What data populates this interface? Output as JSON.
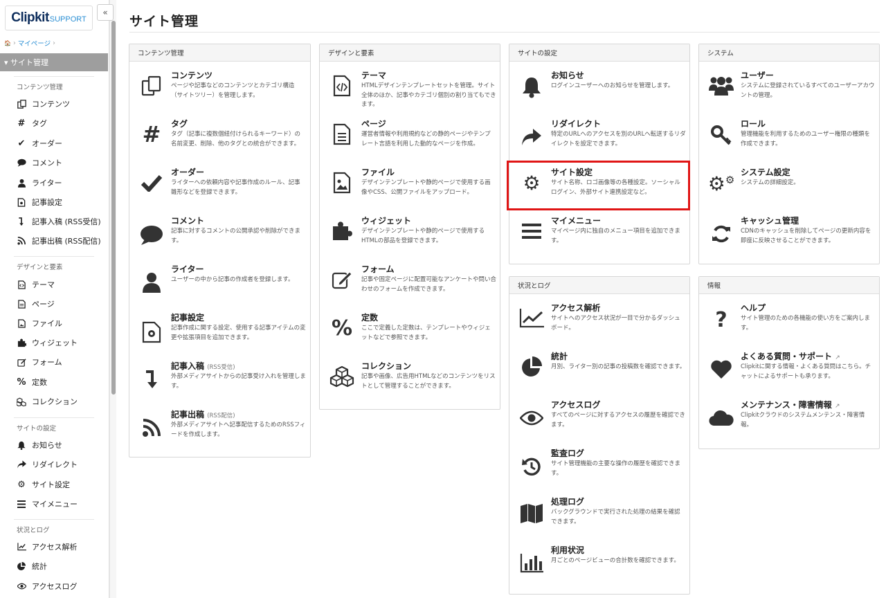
{
  "sidebar": {
    "logo_main": "Clipkit",
    "logo_sub": "SUPPORT",
    "collapse": "«",
    "breadcrumb": {
      "home": "🏠",
      "sep": "›",
      "mypage": "マイページ"
    },
    "active_section": "▾ サイト管理",
    "groups": [
      {
        "title": "コンテンツ管理",
        "items": [
          "コンテンツ",
          "タグ",
          "オーダー",
          "コメント",
          "ライター",
          "記事設定",
          "記事入稿 (RSS受信)",
          "記事出稿 (RSS配信)"
        ]
      },
      {
        "title": "デザインと要素",
        "items": [
          "テーマ",
          "ページ",
          "ファイル",
          "ウィジェット",
          "フォーム",
          "定数",
          "コレクション"
        ]
      },
      {
        "title": "サイトの設定",
        "items": [
          "お知らせ",
          "リダイレクト",
          "サイト設定",
          "マイメニュー"
        ]
      },
      {
        "title": "状況とログ",
        "items": [
          "アクセス解析",
          "統計",
          "アクセスログ"
        ]
      }
    ]
  },
  "main": {
    "title": "サイト管理",
    "panels": {
      "content": {
        "title": "コンテンツ管理",
        "items": [
          {
            "title": "コンテンツ",
            "desc": "ページや記事などのコンテンツとカテゴリ構造（サイトツリー）を管理します。"
          },
          {
            "title": "タグ",
            "desc": "タグ（記事に複数個紐付けられるキーワード）の名前変更、削除、他のタグとの統合ができます。"
          },
          {
            "title": "オーダー",
            "desc": "ライターへの依頼内容や記事作成のルール、記事雛形などを登録できます。"
          },
          {
            "title": "コメント",
            "desc": "記事に対するコメントの公開承認や削除ができます。"
          },
          {
            "title": "ライター",
            "desc": "ユーザーの中から記事の作成者を登録します。"
          },
          {
            "title": "記事設定",
            "desc": "記事作成に関する設定、使用する記事アイテムの変更や拡張項目を追加できます。"
          },
          {
            "title": "記事入稿",
            "sub": "(RSS受信)",
            "desc": "外部メディアサイトからの記事受け入れを管理します。"
          },
          {
            "title": "記事出稿",
            "sub": "(RSS配信)",
            "desc": "外部メディアサイトへ記事配信するためのRSSフィードを作成します。"
          }
        ]
      },
      "design": {
        "title": "デザインと要素",
        "items": [
          {
            "title": "テーマ",
            "desc": "HTMLデザインテンプレートセットを管理。サイト全体のほか、記事やカテゴリ個別の割り当てもできます。"
          },
          {
            "title": "ページ",
            "desc": "運営者情報や利用規約などの静的ページやテンプレート言語を利用した動的なページを作成。"
          },
          {
            "title": "ファイル",
            "desc": "デザインテンプレートや静的ページで使用する画像やCSS、公開ファイルをアップロード。"
          },
          {
            "title": "ウィジェット",
            "desc": "デザインテンプレートや静的ページで使用するHTMLの部品を登録できます。"
          },
          {
            "title": "フォーム",
            "desc": "記事や固定ページに配置可能なアンケートや問い合わせのフォームを作成できます。"
          },
          {
            "title": "定数",
            "desc": "ここで定義した定数は、テンプレートやウィジェットなどで参照できます。"
          },
          {
            "title": "コレクション",
            "desc": "記事や画像、広告用HTMLなどのコンテンツをリストとして管理することができます。"
          }
        ]
      },
      "site": {
        "title": "サイトの設定",
        "items": [
          {
            "title": "お知らせ",
            "desc": "ログインユーザーへのお知らせを管理します。"
          },
          {
            "title": "リダイレクト",
            "desc": "特定のURLへのアクセスを別のURLへ転送するリダイレクトを設定できます。"
          },
          {
            "title": "サイト設定",
            "desc": "サイト名称、ロゴ画像等の各種設定。ソーシャルログイン、外部サイト連携設定など。"
          },
          {
            "title": "マイメニュー",
            "desc": "マイページ内に独自のメニュー項目を追加できます。"
          }
        ]
      },
      "system": {
        "title": "システム",
        "items": [
          {
            "title": "ユーザー",
            "desc": "システムに登録されているすべてのユーザーアカウントの管理。"
          },
          {
            "title": "ロール",
            "desc": "管理機能を利用するためのユーザー権限の種類を作成できます。"
          },
          {
            "title": "システム設定",
            "desc": "システムの詳細設定。"
          },
          {
            "title": "キャッシュ管理",
            "desc": "CDNのキャッシュを削除してページの更新内容を即座に反映させることができます。"
          }
        ]
      },
      "logs": {
        "title": "状況とログ",
        "items": [
          {
            "title": "アクセス解析",
            "desc": "サイトへのアクセス状況が一目で分かるダッシュボード。"
          },
          {
            "title": "統計",
            "desc": "月別、ライター別の記事の投稿数を確認できます。"
          },
          {
            "title": "アクセスログ",
            "desc": "すべてのページに対するアクセスの履歴を確認できます。"
          },
          {
            "title": "監査ログ",
            "desc": "サイト管理機能の主要な操作の履歴を確認できます。"
          },
          {
            "title": "処理ログ",
            "desc": "バックグラウンドで実行された処理の結果を確認できます。"
          },
          {
            "title": "利用状況",
            "desc": "月ごとのページビューの合計数を確認できます。"
          }
        ]
      },
      "info": {
        "title": "情報",
        "items": [
          {
            "title": "ヘルプ",
            "desc": "サイト管理のための各機能の使い方をご案内します。"
          },
          {
            "title": "よくある質問・サポート",
            "ext": "↗",
            "desc": "Clipkitに関する情報・よくある質問はこちら。チャットによるサポートも承ります。"
          },
          {
            "title": "メンテナンス・障害情報",
            "ext": "↗",
            "desc": "Clipkitクラウドのシステムメンテンス・障害情報。"
          }
        ]
      }
    }
  },
  "colors": {
    "accent": "#2b8fd4",
    "highlight": "#e01515",
    "icon": "#333333",
    "active_bg": "#9e9e9e"
  }
}
